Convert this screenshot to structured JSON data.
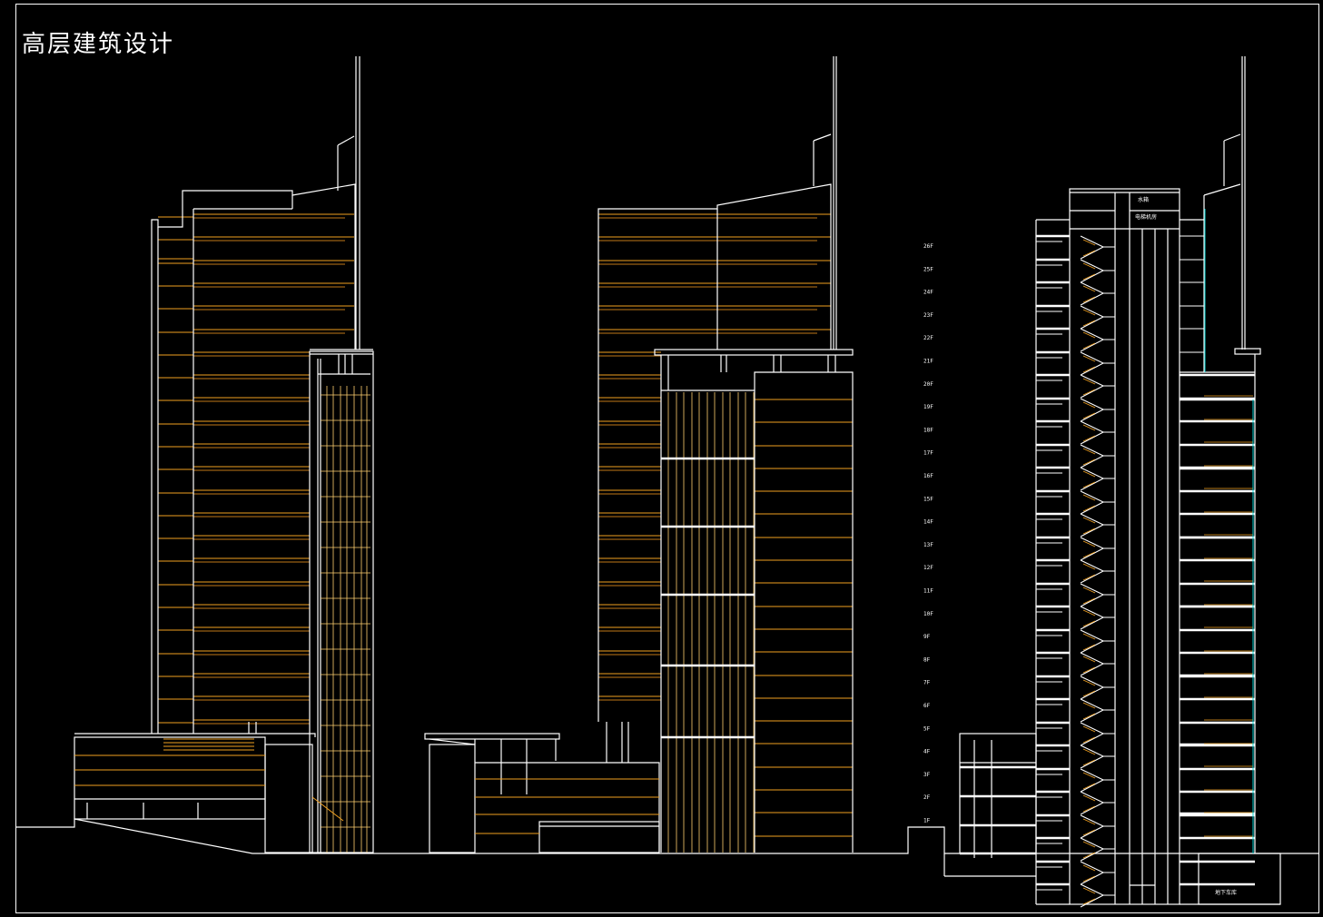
{
  "drawing": {
    "title": "高层建筑设计",
    "colors": {
      "background": "#000000",
      "outline": "#ffffff",
      "floor_line": "#f0a020",
      "mullion": "#ffd070",
      "glass": "#00d0d0",
      "accent": "#ffb0ff"
    },
    "floor_labels": [
      "26F",
      "25F",
      "24F",
      "23F",
      "22F",
      "21F",
      "20F",
      "19F",
      "18F",
      "17F",
      "16F",
      "15F",
      "14F",
      "13F",
      "12F",
      "11F",
      "10F",
      "9F",
      "8F",
      "7F",
      "6F",
      "5F",
      "4F",
      "3F",
      "2F",
      "1F"
    ],
    "section_labels": {
      "top_room": "水箱",
      "machine_room": "电梯机房",
      "basement": "地下车库"
    }
  }
}
